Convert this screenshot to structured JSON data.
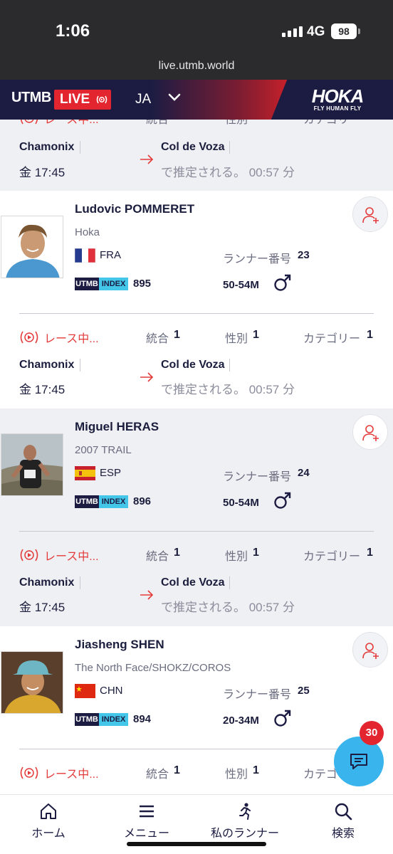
{
  "status_bar": {
    "time": "1:06",
    "network": "4G",
    "battery": "98"
  },
  "browser": {
    "url": "live.utmb.world"
  },
  "header": {
    "brand": "UTMB",
    "live_label": "LIVE",
    "language": "JA",
    "sponsor_logo": "HOKA",
    "sponsor_tagline": "FLY HUMAN FLY"
  },
  "labels": {
    "status": "レース中...",
    "overall": "統合",
    "gender": "性別",
    "category": "カテゴリー",
    "bib": "ランナー番号",
    "index_badge_a": "UTMB",
    "index_badge_b": "INDEX",
    "estimated": "で推定される。 00:57 分",
    "location_from": "Chamonix",
    "location_to": "Col de Voza",
    "departure": "金 17:45"
  },
  "runners": [
    {
      "name": "Ludovic POMMERET",
      "team": "Hoka",
      "country": "FRA",
      "bib": "23",
      "utmb_index": "895",
      "category": "50-54M",
      "rank_overall": "1",
      "rank_gender": "1",
      "rank_category": "1"
    },
    {
      "name": "Miguel HERAS",
      "team": "2007 TRAIL",
      "country": "ESP",
      "bib": "24",
      "utmb_index": "896",
      "category": "50-54M",
      "rank_overall": "1",
      "rank_gender": "1",
      "rank_category": "1"
    },
    {
      "name": "Jiasheng SHEN",
      "team": "The North Face/SHOKZ/COROS",
      "country": "CHN",
      "bib": "25",
      "utmb_index": "894",
      "category": "20-34M",
      "rank_overall": "1",
      "rank_gender": "1",
      "rank_category": "1"
    }
  ],
  "top_partial": {
    "rank_overall": "1",
    "rank_gender": "1",
    "rank_category": "1"
  },
  "chat": {
    "unread": "30"
  },
  "bottom_nav": {
    "home": "ホーム",
    "menu": "メニュー",
    "my_runners": "私のランナー",
    "search": "検索"
  },
  "colors": {
    "navy": "#1c1c43",
    "red": "#e2252f",
    "cyan": "#43c6e8",
    "chat": "#39b4ec"
  }
}
